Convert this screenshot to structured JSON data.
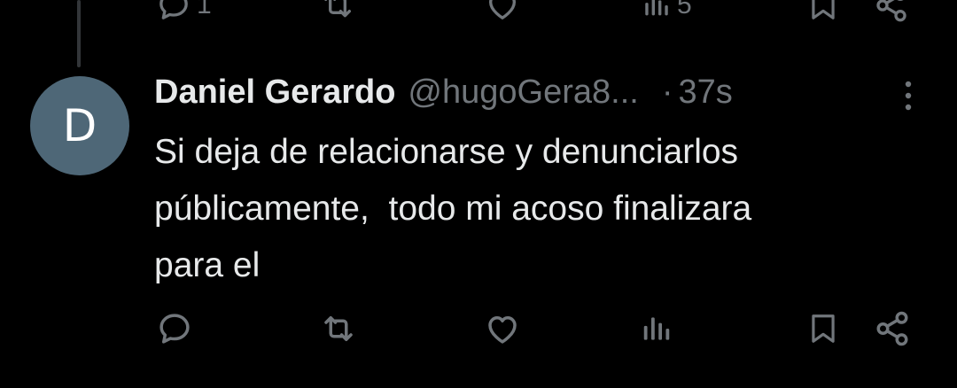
{
  "previous_tweet": {
    "reply_count": "1",
    "views_count": "5"
  },
  "tweet": {
    "avatar_letter": "D",
    "avatar_color": "#4e6777",
    "display_name": "Daniel Gerardo",
    "handle": "@hugoGera8...",
    "separator": "·",
    "time": "37s",
    "text": "Si deja de relacionarse y denunciarlos\npúblicamente,  todo mi acoso finalizara\npara el"
  },
  "icons": {
    "reply": "reply-icon",
    "retweet": "retweet-icon",
    "like": "heart-icon",
    "views": "views-icon",
    "bookmark": "bookmark-icon",
    "share": "share-icon",
    "more": "more-vertical-icon"
  },
  "colors": {
    "background": "#000000",
    "primary_text": "#e7e9ea",
    "secondary_text": "#71767b",
    "thread_line": "#333639"
  }
}
